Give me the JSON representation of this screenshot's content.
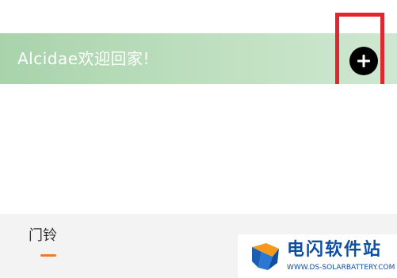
{
  "banner": {
    "title": "Alcidae欢迎回家!",
    "add_icon": "plus-icon"
  },
  "tabs": [
    {
      "label": "门铃",
      "active": true
    }
  ],
  "watermark": {
    "name": "电闪软件站",
    "url": "WWW.DS-SOLARBATTERY.COM"
  },
  "colors": {
    "banner_green": "#a8d3ab",
    "highlight_red": "#e0262f",
    "tab_active_orange": "#f07a2a",
    "watermark_blue": "#0e4fa3"
  }
}
